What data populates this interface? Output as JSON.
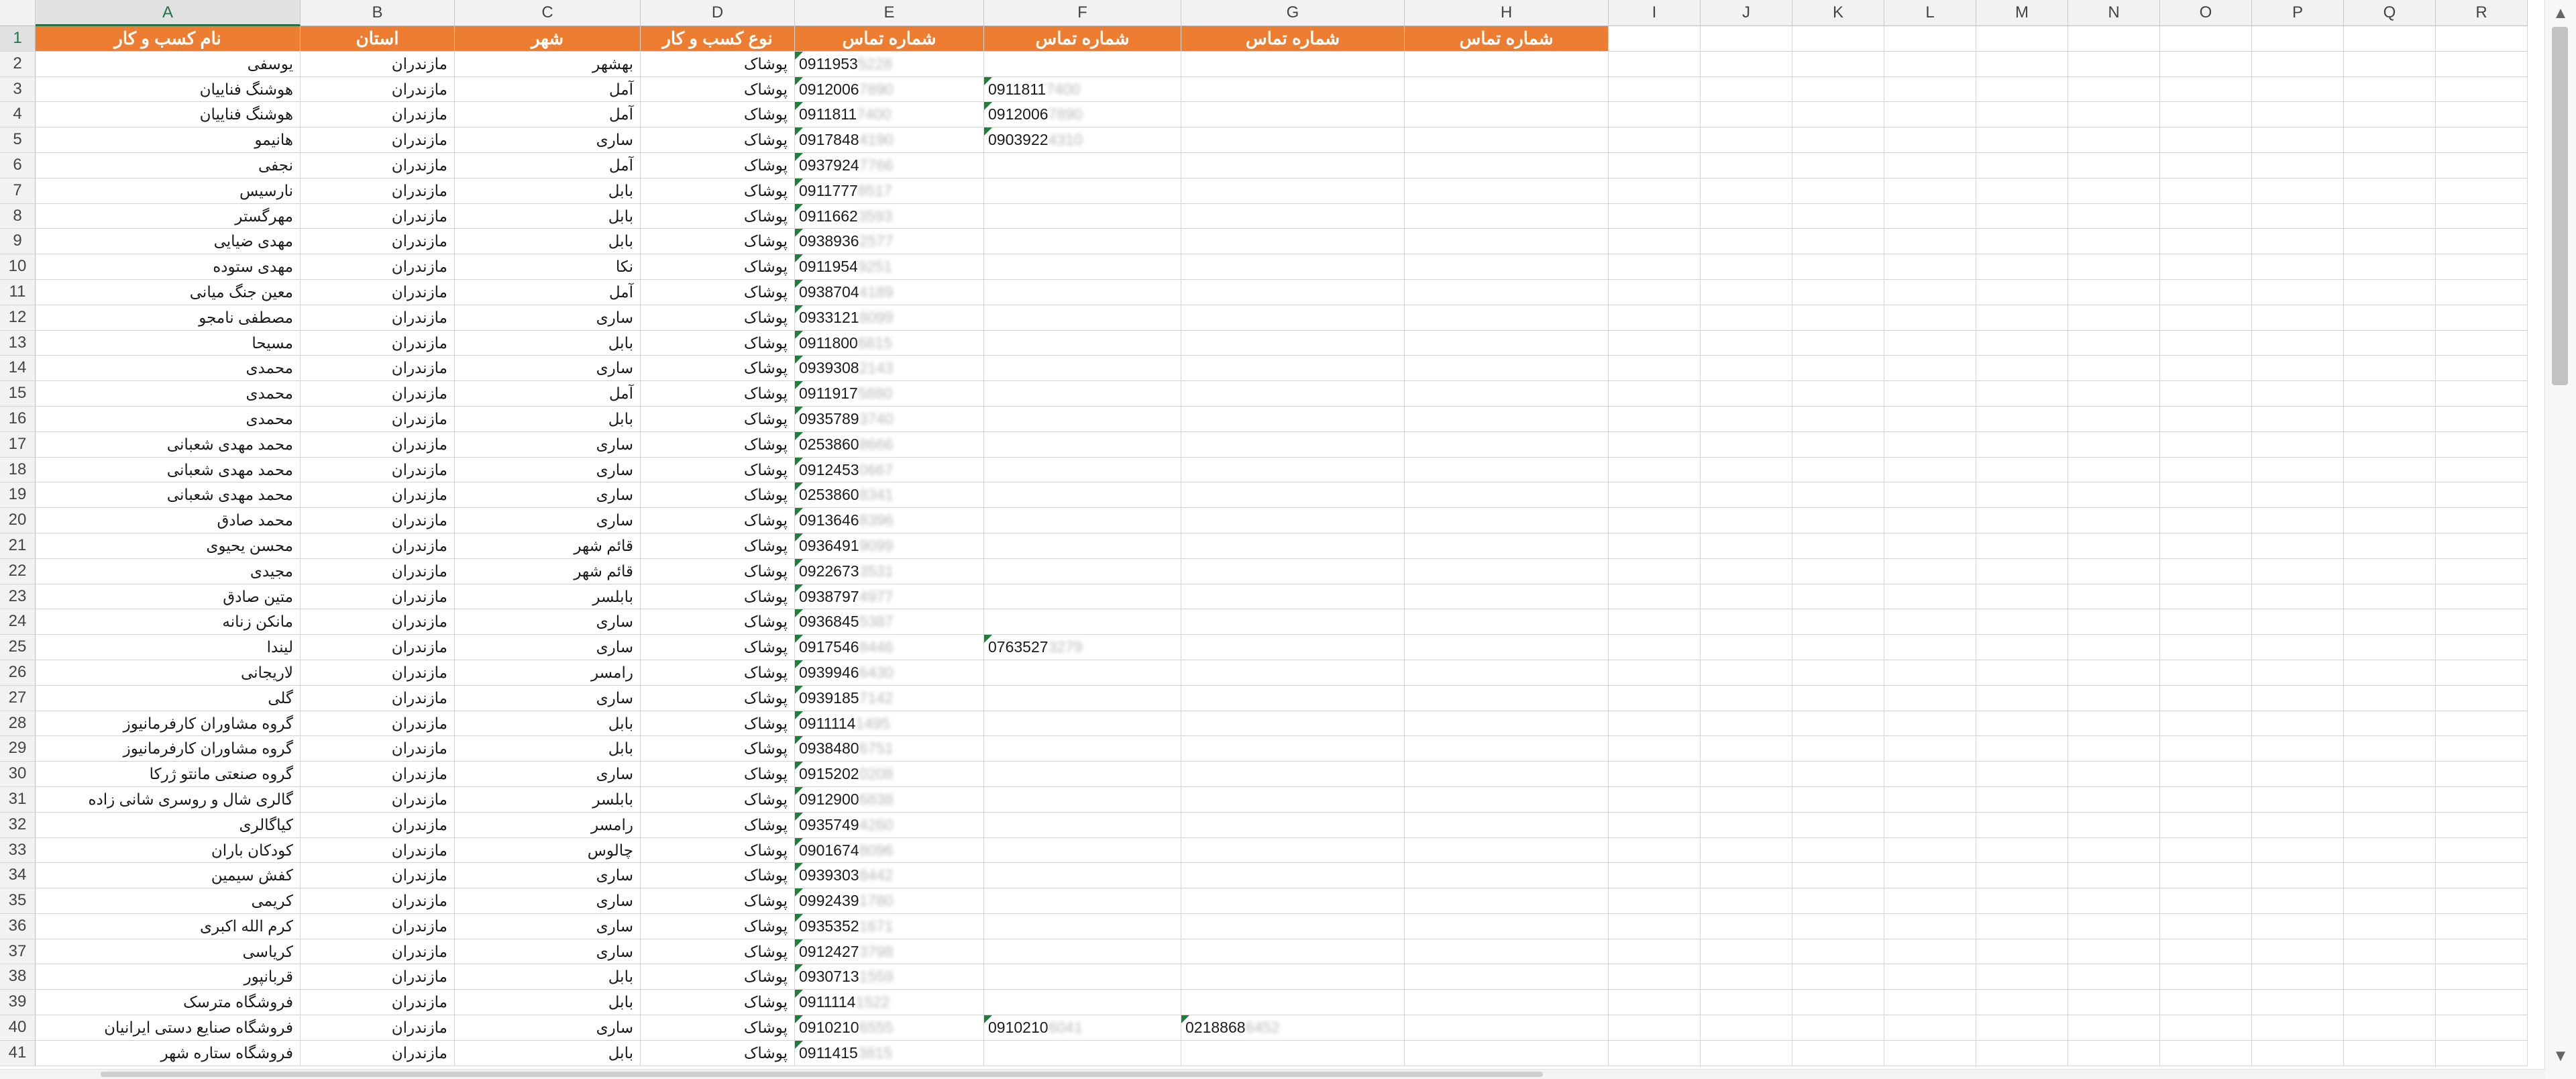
{
  "columns": [
    "A",
    "B",
    "C",
    "D",
    "E",
    "F",
    "G",
    "H",
    "I",
    "J",
    "K",
    "L",
    "M",
    "N",
    "O",
    "P",
    "Q",
    "R"
  ],
  "selected_column": "A",
  "header": {
    "business_name": "نام کسب و کار",
    "province": "استان",
    "city": "شهر",
    "business_type": "نوع کسب و کار",
    "phone1": "شماره تماس",
    "phone2": "شماره تماس",
    "phone3": "شماره تماس",
    "phone4": "شماره تماس"
  },
  "rows": [
    {
      "num": "2",
      "name": "یوسفی",
      "prov": "مازندران",
      "city": "بهشهر",
      "type": "پوشاک",
      "p1": "0911953",
      "p1h": "5228",
      "p2": "",
      "p2h": "",
      "p3": "",
      "p3h": ""
    },
    {
      "num": "3",
      "name": "هوشنگ فناییان",
      "prov": "مازندران",
      "city": "آمل",
      "type": "پوشاک",
      "p1": "0912006",
      "p1h": "7890",
      "p2": "0911811",
      "p2h": "7400",
      "p3": "",
      "p3h": ""
    },
    {
      "num": "4",
      "name": "هوشنگ فناییان",
      "prov": "مازندران",
      "city": "آمل",
      "type": "پوشاک",
      "p1": "0911811",
      "p1h": "7400",
      "p2": "0912006",
      "p2h": "7890",
      "p3": "",
      "p3h": ""
    },
    {
      "num": "5",
      "name": "هانیمو",
      "prov": "مازندران",
      "city": "ساری",
      "type": "پوشاک",
      "p1": "0917848",
      "p1h": "4190",
      "p2": "0903922",
      "p2h": "4310",
      "p3": "",
      "p3h": ""
    },
    {
      "num": "6",
      "name": "نجفی",
      "prov": "مازندران",
      "city": "آمل",
      "type": "پوشاک",
      "p1": "0937924",
      "p1h": "7766",
      "p2": "",
      "p2h": "",
      "p3": "",
      "p3h": ""
    },
    {
      "num": "7",
      "name": "نارسیس",
      "prov": "مازندران",
      "city": "بابل",
      "type": "پوشاک",
      "p1": "0911777",
      "p1h": "8517",
      "p2": "",
      "p2h": "",
      "p3": "",
      "p3h": ""
    },
    {
      "num": "8",
      "name": "مهرگستر",
      "prov": "مازندران",
      "city": "بابل",
      "type": "پوشاک",
      "p1": "0911662",
      "p1h": "3593",
      "p2": "",
      "p2h": "",
      "p3": "",
      "p3h": ""
    },
    {
      "num": "9",
      "name": "مهدی ضیایی",
      "prov": "مازندران",
      "city": "بابل",
      "type": "پوشاک",
      "p1": "0938936",
      "p1h": "2577",
      "p2": "",
      "p2h": "",
      "p3": "",
      "p3h": ""
    },
    {
      "num": "10",
      "name": "مهدی ستوده",
      "prov": "مازندران",
      "city": "نکا",
      "type": "پوشاک",
      "p1": "0911954",
      "p1h": "9251",
      "p2": "",
      "p2h": "",
      "p3": "",
      "p3h": ""
    },
    {
      "num": "11",
      "name": "معین جنگ میانی",
      "prov": "مازندران",
      "city": "آمل",
      "type": "پوشاک",
      "p1": "0938704",
      "p1h": "4189",
      "p2": "",
      "p2h": "",
      "p3": "",
      "p3h": ""
    },
    {
      "num": "12",
      "name": "مصطفی نامجو",
      "prov": "مازندران",
      "city": "ساری",
      "type": "پوشاک",
      "p1": "0933121",
      "p1h": "8099",
      "p2": "",
      "p2h": "",
      "p3": "",
      "p3h": ""
    },
    {
      "num": "13",
      "name": "مسیحا",
      "prov": "مازندران",
      "city": "بابل",
      "type": "پوشاک",
      "p1": "0911800",
      "p1h": "6815",
      "p2": "",
      "p2h": "",
      "p3": "",
      "p3h": ""
    },
    {
      "num": "14",
      "name": "محمدی",
      "prov": "مازندران",
      "city": "ساری",
      "type": "پوشاک",
      "p1": "0939308",
      "p1h": "2143",
      "p2": "",
      "p2h": "",
      "p3": "",
      "p3h": ""
    },
    {
      "num": "15",
      "name": "محمدی",
      "prov": "مازندران",
      "city": "آمل",
      "type": "پوشاک",
      "p1": "0911917",
      "p1h": "5880",
      "p2": "",
      "p2h": "",
      "p3": "",
      "p3h": ""
    },
    {
      "num": "16",
      "name": "محمدی",
      "prov": "مازندران",
      "city": "بابل",
      "type": "پوشاک",
      "p1": "0935789",
      "p1h": "3740",
      "p2": "",
      "p2h": "",
      "p3": "",
      "p3h": ""
    },
    {
      "num": "17",
      "name": "محمد مهدی شعبانی",
      "prov": "مازندران",
      "city": "ساری",
      "type": "پوشاک",
      "p1": "0253860",
      "p1h": "8666",
      "p2": "",
      "p2h": "",
      "p3": "",
      "p3h": ""
    },
    {
      "num": "18",
      "name": "محمد مهدی شعبانی",
      "prov": "مازندران",
      "city": "ساری",
      "type": "پوشاک",
      "p1": "0912453",
      "p1h": "0667",
      "p2": "",
      "p2h": "",
      "p3": "",
      "p3h": ""
    },
    {
      "num": "19",
      "name": "محمد مهدی شعبانی",
      "prov": "مازندران",
      "city": "ساری",
      "type": "پوشاک",
      "p1": "0253860",
      "p1h": "8341",
      "p2": "",
      "p2h": "",
      "p3": "",
      "p3h": ""
    },
    {
      "num": "20",
      "name": "محمد صادق",
      "prov": "مازندران",
      "city": "ساری",
      "type": "پوشاک",
      "p1": "0913646",
      "p1h": "8396",
      "p2": "",
      "p2h": "",
      "p3": "",
      "p3h": ""
    },
    {
      "num": "21",
      "name": "محسن یحیوی",
      "prov": "مازندران",
      "city": "قائم شهر",
      "type": "پوشاک",
      "p1": "0936491",
      "p1h": "9099",
      "p2": "",
      "p2h": "",
      "p3": "",
      "p3h": ""
    },
    {
      "num": "22",
      "name": "مجیدی",
      "prov": "مازندران",
      "city": "قائم شهر",
      "type": "پوشاک",
      "p1": "0922673",
      "p1h": "3531",
      "p2": "",
      "p2h": "",
      "p3": "",
      "p3h": ""
    },
    {
      "num": "23",
      "name": "متین صادق",
      "prov": "مازندران",
      "city": "بابلسر",
      "type": "پوشاک",
      "p1": "0938797",
      "p1h": "4977",
      "p2": "",
      "p2h": "",
      "p3": "",
      "p3h": ""
    },
    {
      "num": "24",
      "name": "مانکن زنانه",
      "prov": "مازندران",
      "city": "ساری",
      "type": "پوشاک",
      "p1": "0936845",
      "p1h": "5387",
      "p2": "",
      "p2h": "",
      "p3": "",
      "p3h": ""
    },
    {
      "num": "25",
      "name": "لیندا",
      "prov": "مازندران",
      "city": "ساری",
      "type": "پوشاک",
      "p1": "0917546",
      "p1h": "8446",
      "p2": "0763527",
      "p2h": "3279",
      "p3": "",
      "p3h": ""
    },
    {
      "num": "26",
      "name": "لاریجانی",
      "prov": "مازندران",
      "city": "رامسر",
      "type": "پوشاک",
      "p1": "0939946",
      "p1h": "6430",
      "p2": "",
      "p2h": "",
      "p3": "",
      "p3h": ""
    },
    {
      "num": "27",
      "name": "گلی",
      "prov": "مازندران",
      "city": "ساری",
      "type": "پوشاک",
      "p1": "0939185",
      "p1h": "7142",
      "p2": "",
      "p2h": "",
      "p3": "",
      "p3h": ""
    },
    {
      "num": "28",
      "name": "گروه مشاوران کارفرمانیوز",
      "prov": "مازندران",
      "city": "بابل",
      "type": "پوشاک",
      "p1": "0911114",
      "p1h": "1495",
      "p2": "",
      "p2h": "",
      "p3": "",
      "p3h": ""
    },
    {
      "num": "29",
      "name": "گروه مشاوران کارفرمانیوز",
      "prov": "مازندران",
      "city": "بابل",
      "type": "پوشاک",
      "p1": "0938480",
      "p1h": "6751",
      "p2": "",
      "p2h": "",
      "p3": "",
      "p3h": ""
    },
    {
      "num": "30",
      "name": "گروه صنعتی مانتو ژرکا",
      "prov": "مازندران",
      "city": "ساری",
      "type": "پوشاک",
      "p1": "0915202",
      "p1h": "0208",
      "p2": "",
      "p2h": "",
      "p3": "",
      "p3h": ""
    },
    {
      "num": "31",
      "name": "گالری شال و روسری شانی زاده",
      "prov": "مازندران",
      "city": "بابلسر",
      "type": "پوشاک",
      "p1": "0912900",
      "p1h": "6838",
      "p2": "",
      "p2h": "",
      "p3": "",
      "p3h": ""
    },
    {
      "num": "32",
      "name": "کیاگالری",
      "prov": "مازندران",
      "city": "رامسر",
      "type": "پوشاک",
      "p1": "0935749",
      "p1h": "4260",
      "p2": "",
      "p2h": "",
      "p3": "",
      "p3h": ""
    },
    {
      "num": "33",
      "name": "کودکان باران",
      "prov": "مازندران",
      "city": "چالوس",
      "type": "پوشاک",
      "p1": "0901674",
      "p1h": "8096",
      "p2": "",
      "p2h": "",
      "p3": "",
      "p3h": ""
    },
    {
      "num": "34",
      "name": "کفش سیمین",
      "prov": "مازندران",
      "city": "ساری",
      "type": "پوشاک",
      "p1": "0939303",
      "p1h": "8442",
      "p2": "",
      "p2h": "",
      "p3": "",
      "p3h": ""
    },
    {
      "num": "35",
      "name": "کریمی",
      "prov": "مازندران",
      "city": "ساری",
      "type": "پوشاک",
      "p1": "0992439",
      "p1h": "1780",
      "p2": "",
      "p2h": "",
      "p3": "",
      "p3h": ""
    },
    {
      "num": "36",
      "name": "کرم الله اکبری",
      "prov": "مازندران",
      "city": "ساری",
      "type": "پوشاک",
      "p1": "0935352",
      "p1h": "1671",
      "p2": "",
      "p2h": "",
      "p3": "",
      "p3h": ""
    },
    {
      "num": "37",
      "name": "کریاسی",
      "prov": "مازندران",
      "city": "ساری",
      "type": "پوشاک",
      "p1": "0912427",
      "p1h": "3798",
      "p2": "",
      "p2h": "",
      "p3": "",
      "p3h": ""
    },
    {
      "num": "38",
      "name": "قربانپور",
      "prov": "مازندران",
      "city": "بابل",
      "type": "پوشاک",
      "p1": "0930713",
      "p1h": "1559",
      "p2": "",
      "p2h": "",
      "p3": "",
      "p3h": ""
    },
    {
      "num": "39",
      "name": "فروشگاه مترسک",
      "prov": "مازندران",
      "city": "بابل",
      "type": "پوشاک",
      "p1": "0911114",
      "p1h": "1522",
      "p2": "",
      "p2h": "",
      "p3": "",
      "p3h": ""
    },
    {
      "num": "40",
      "name": "فروشگاه صنایع دستی ایرانیان",
      "prov": "مازندران",
      "city": "ساری",
      "type": "پوشاک",
      "p1": "0910210",
      "p1h": "6555",
      "p2": "0910210",
      "p2h": "6041",
      "p3": "0218868",
      "p3h": "6452"
    },
    {
      "num": "41",
      "name": "فروشگاه ستاره شهر",
      "prov": "مازندران",
      "city": "بابل",
      "type": "پوشاک",
      "p1": "0911415",
      "p1h": "3815",
      "p2": "",
      "p2h": "",
      "p3": "",
      "p3h": ""
    }
  ],
  "colors": {
    "header_fill": "#ed7d31",
    "header_text": "#ffffff",
    "selection_green": "#217346",
    "error_triangle": "#1e7f3a"
  }
}
